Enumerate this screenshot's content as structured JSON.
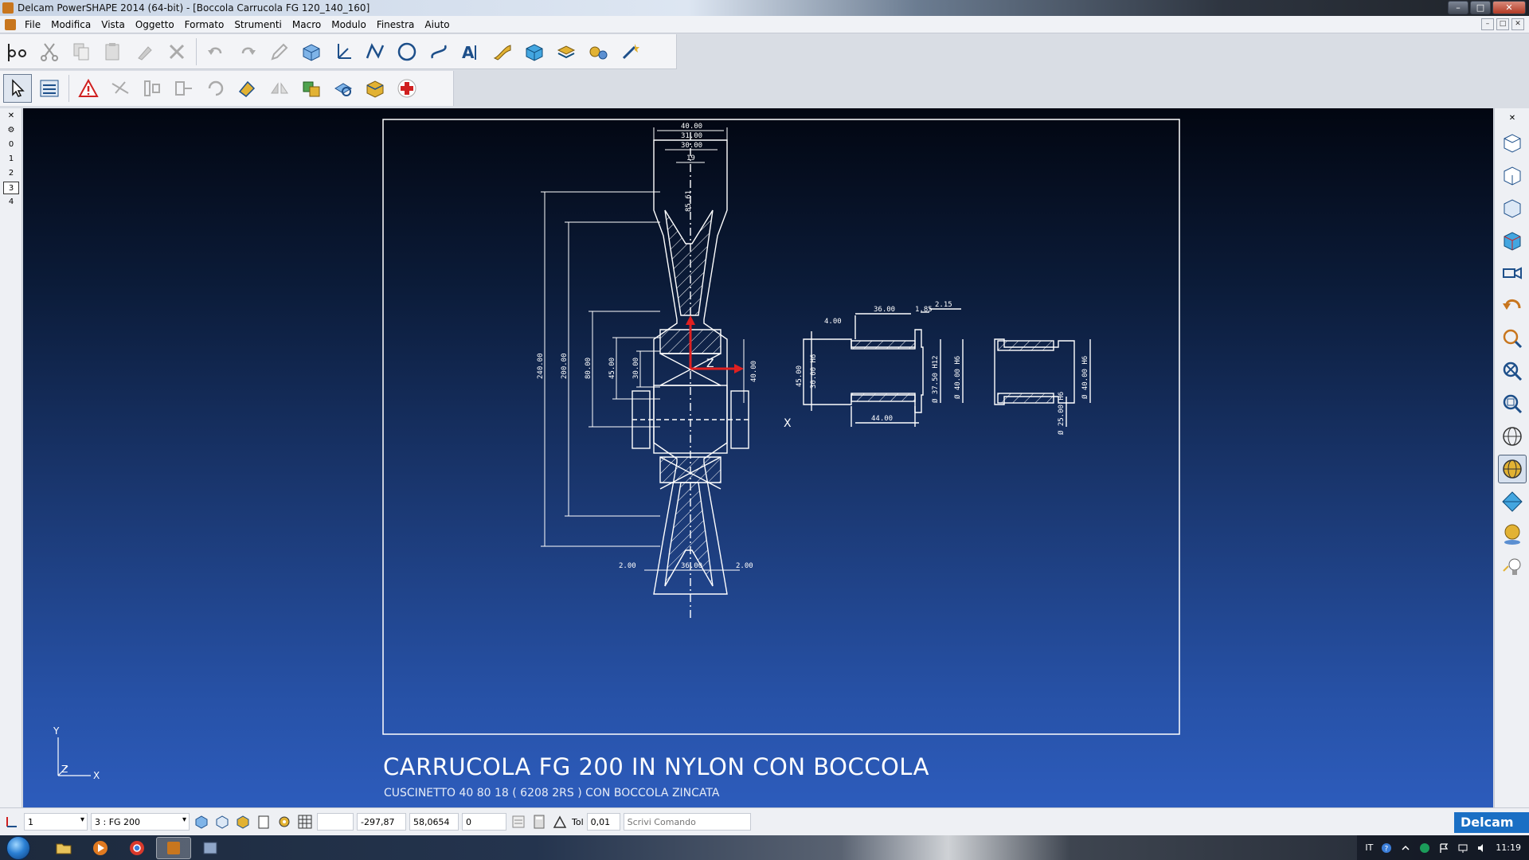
{
  "window": {
    "title": "Delcam PowerSHAPE 2014 (64-bit) - [Boccola Carrucola FG 120_140_160]",
    "minimize_glyph": "–",
    "maximize_glyph": "□",
    "close_glyph": "✕"
  },
  "menu": {
    "items": [
      "File",
      "Modifica",
      "Vista",
      "Oggetto",
      "Formato",
      "Strumenti",
      "Macro",
      "Modulo",
      "Finestra",
      "Aiuto"
    ]
  },
  "levels": {
    "items": [
      "0",
      "1",
      "2",
      "3",
      "4"
    ],
    "active": "3"
  },
  "drawing": {
    "dims_left": [
      "40.00",
      "31.00",
      "30.00",
      "19",
      "85.61",
      "240.00",
      "200.00",
      "80.00",
      "45.00",
      "30.00",
      "40.00",
      "2.00",
      "36.00",
      "2.00"
    ],
    "dims_right": [
      "2.15",
      "36.00",
      "1.85",
      "4.00",
      "45.00",
      "30.00 H6",
      "Ø 37.50 H12",
      "Ø 40.00 H6",
      "44.00",
      "Ø 40.00 H6",
      "Ø 25.00 H6"
    ],
    "axis_labels": {
      "x": "X",
      "y": "Y",
      "z": "Z"
    },
    "title": "CARRUCOLA FG 200 IN NYLON CON BOCCOLA",
    "subtitle": "CUSCINETTO 40 80 18 ( 6208 2RS ) CON BOCCOLA ZINCATA",
    "colors": {
      "line": "#ffffff",
      "axis": "#e02020",
      "background_top": "#020611",
      "background_bottom": "#2d5cbc"
    }
  },
  "status": {
    "workplane": "1",
    "level": "3   : FG 200",
    "x": "-297,87",
    "y": "58,0654",
    "z": "0",
    "tol_label": "Tol",
    "tol_value": "0,01",
    "command_placeholder": "Scrivi Comando",
    "logo": "Delcam"
  },
  "taskbar": {
    "language": "IT",
    "clock": "11:19"
  }
}
